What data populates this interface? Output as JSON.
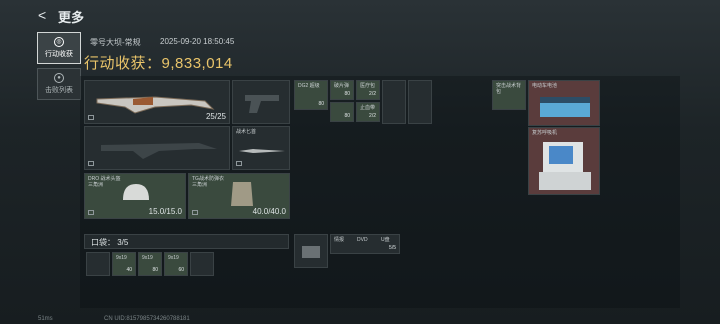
{
  "header": {
    "back_icon": "<",
    "title": "更多"
  },
  "sidebar": {
    "items": [
      {
        "label": "行动收获"
      },
      {
        "label": "击败列表"
      }
    ]
  },
  "match": {
    "map": "零号大坝-常规",
    "time": "2025-09-20 18:50:45",
    "earnings": "行动收获：9,833,014"
  },
  "grid": {
    "rifle_count": "25/25",
    "knife_label": "战术匕首",
    "helmet_label": "DRO 战术头盔\n三角洲",
    "helmet_val": "15.0/15.0",
    "vest_label": "TG战术防弹衣\n三角洲",
    "vest_val": "40.0/40.0",
    "ammo1_label": "DG2 超级",
    "ammo1_cnt": "80",
    "ammo2_label": "破片弹",
    "ammo2_cnt": "80",
    "med1_label": "医疗包",
    "med1_cnt": "2/2",
    "med2_label": "止血带",
    "med2_cnt": "2/2",
    "bag_label": "突击战术背包",
    "battery_label": "电动车电池",
    "monitor_label": "复苏呼吸机",
    "pocket": "口袋： 3/5",
    "pocket_items": [
      {
        "label": "9x19",
        "cnt": "40"
      },
      {
        "label": "9x19",
        "cnt": "80"
      },
      {
        "label": "9x19",
        "cnt": "60"
      }
    ],
    "box_label": "情报",
    "box2_label": "DVD",
    "box3_label": "U盘",
    "box_cnt": "5/5"
  },
  "footer": {
    "ping": "51ms",
    "uid": "CN UID:8157985734260788181"
  }
}
